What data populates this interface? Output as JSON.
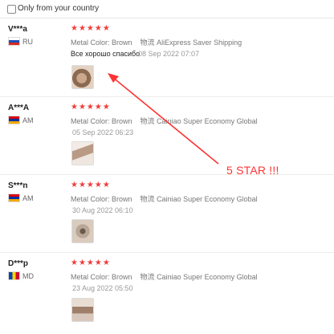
{
  "filter": {
    "label": "Only from your country",
    "checked": false
  },
  "reviews": [
    {
      "user": "V***a",
      "country_code": "RU",
      "rating": 5,
      "stars": "★★★★★",
      "meta": "Metal Color: Brown",
      "logistics_prefix": "物流",
      "shipping": "AliExpress Saver Shipping",
      "feedback": "Все хорошо спасибо",
      "date": "08 Sep 2022 07:07"
    },
    {
      "user": "A***A",
      "country_code": "AM",
      "rating": 5,
      "stars": "★★★★★",
      "meta": "Metal Color: Brown",
      "logistics_prefix": "物流",
      "shipping": "Cainiao Super Economy Global",
      "feedback": "",
      "date": "05 Sep 2022 06:23"
    },
    {
      "user": "S***n",
      "country_code": "AM",
      "rating": 5,
      "stars": "★★★★★",
      "meta": "Metal Color: Brown",
      "logistics_prefix": "物流",
      "shipping": "Cainiao Super Economy Global",
      "feedback": "",
      "date": "30 Aug 2022 06:10"
    },
    {
      "user": "D***p",
      "country_code": "MD",
      "rating": 5,
      "stars": "★★★★★",
      "meta": "Metal Color: Brown",
      "logistics_prefix": "物流",
      "shipping": "Cainiao Super Economy Global",
      "feedback": "",
      "date": "23 Aug 2022 05:50"
    }
  ],
  "annotation": {
    "text": "5 STAR !!!",
    "color": "#ff3333"
  },
  "colors": {
    "star": "#f03c3c",
    "muted": "#777777",
    "date": "#999999"
  }
}
